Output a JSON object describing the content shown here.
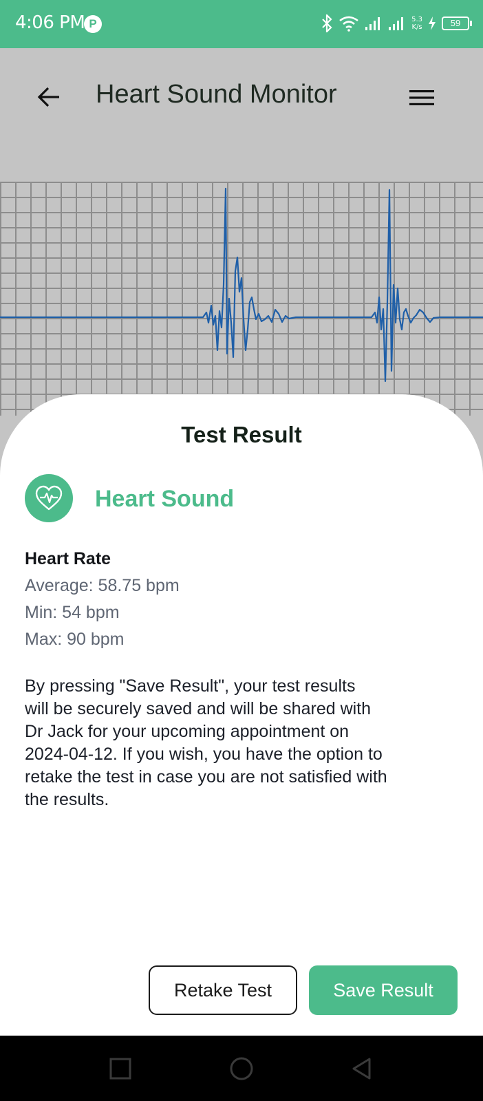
{
  "status_bar": {
    "time": "4:06 PM",
    "app_icon": "P",
    "net_speed_value": "5.3",
    "net_speed_unit": "K/s",
    "battery": "59"
  },
  "header": {
    "title": "Heart Sound Monitor",
    "back_icon": "arrow-left-icon",
    "menu_icon": "hamburger-menu-icon"
  },
  "result": {
    "sheet_title": "Test Result",
    "section_title": "Heart Sound",
    "section_icon": "heart-pulse-icon",
    "heart_rate_heading": "Heart Rate",
    "average": "Average: 58.75 bpm",
    "min": "Min: 54 bpm",
    "max": "Max: 90 bpm",
    "info_text": "By pressing \"Save Result\", your test results\nwill be securely saved and will be shared with\nDr  Jack for your upcoming appointment on\n2024-04-12. If you wish, you have the option to\nretake the test in case you are not satisfied with\nthe results."
  },
  "actions": {
    "retake_label": "Retake Test",
    "save_label": "Save Result"
  },
  "colors": {
    "accent": "#4cbb8b",
    "waveform": "#1f5fa8",
    "background": "#c4c4c4",
    "grid": "#8d8d8d"
  }
}
